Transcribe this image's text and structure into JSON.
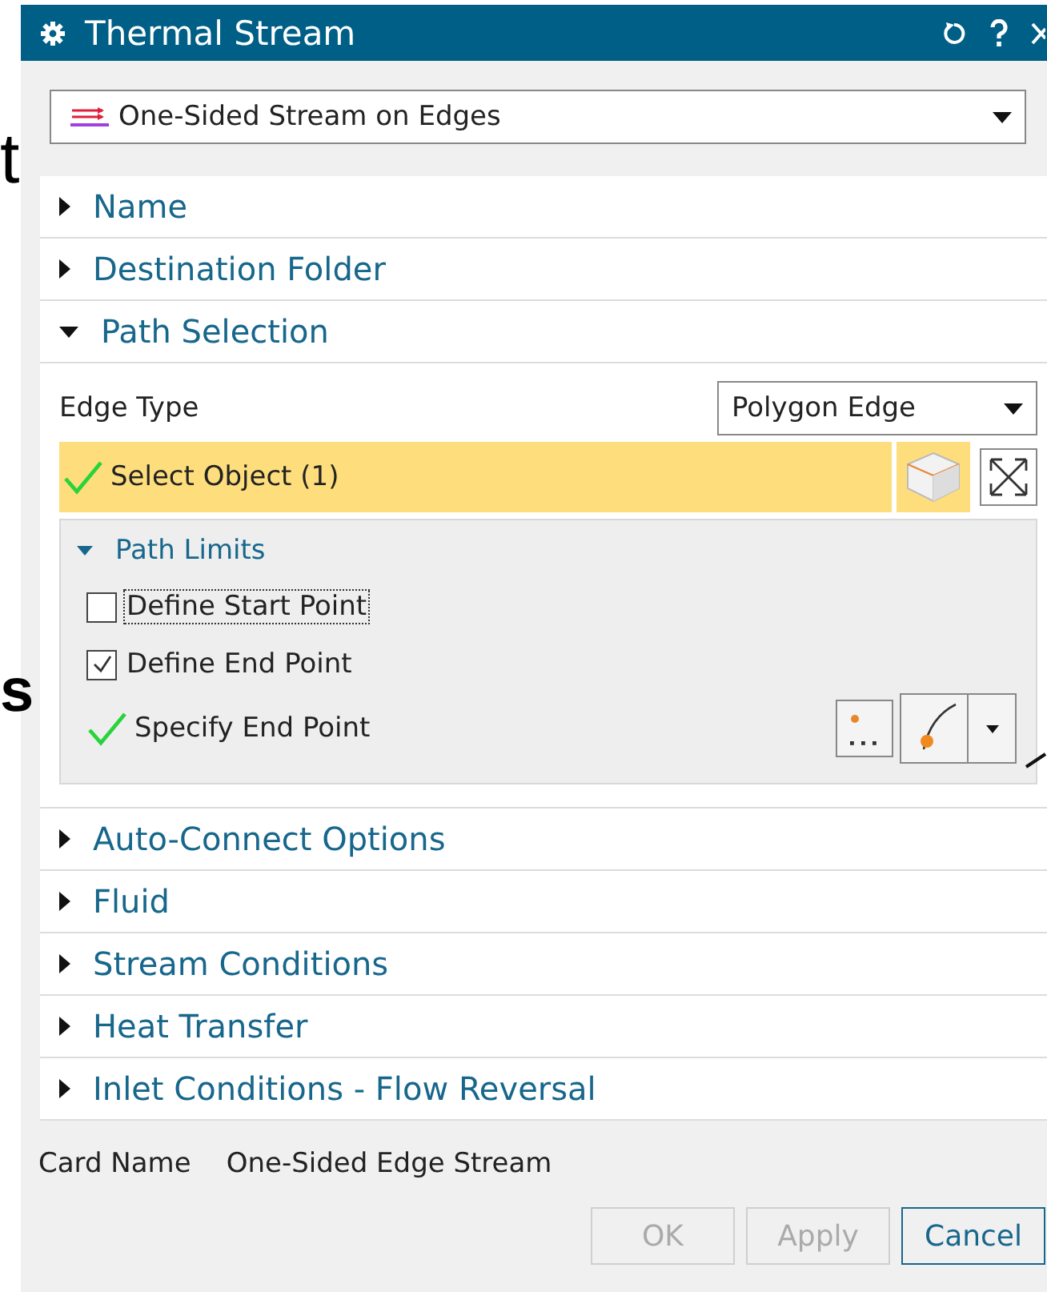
{
  "background_text": [
    {
      "text": "t"
    },
    {
      "text": "s"
    }
  ],
  "window": {
    "title": "Thermal Stream"
  },
  "type_dropdown": {
    "value": "One-Sided Stream on Edges"
  },
  "sections": [
    {
      "label": "Name",
      "expanded": false,
      "kind": "plain"
    },
    {
      "label": "Destination Folder",
      "expanded": false,
      "kind": "plain"
    },
    {
      "label": "Path Selection",
      "expanded": true,
      "kind": "path_selection"
    },
    {
      "label": "Auto-Connect Options",
      "expanded": false,
      "kind": "plain"
    },
    {
      "label": "Fluid",
      "expanded": false,
      "kind": "plain"
    },
    {
      "label": "Stream Conditions",
      "expanded": false,
      "kind": "plain"
    },
    {
      "label": "Heat Transfer",
      "expanded": false,
      "kind": "plain"
    },
    {
      "label": "Inlet Conditions - Flow Reversal",
      "expanded": false,
      "kind": "plain"
    }
  ],
  "path_selection": {
    "edge_type": {
      "label": "Edge Type",
      "value": "Polygon Edge"
    },
    "select_object": {
      "label": "Select Object (1)",
      "complete": true
    },
    "path_limits": {
      "label": "Path Limits",
      "expanded": true,
      "options": [
        {
          "label": "Define Start Point",
          "checked": false,
          "focused": true
        },
        {
          "label": "Define End Point",
          "checked": true,
          "focused": false
        }
      ],
      "specify": {
        "label": "Specify End Point",
        "complete": true
      }
    }
  },
  "card_name": {
    "label": "Card Name",
    "value": "One-Sided Edge Stream"
  },
  "buttons": [
    {
      "label": "OK",
      "disabled": true
    },
    {
      "label": "Apply",
      "disabled": true
    },
    {
      "label": "Cancel",
      "disabled": false
    }
  ]
}
